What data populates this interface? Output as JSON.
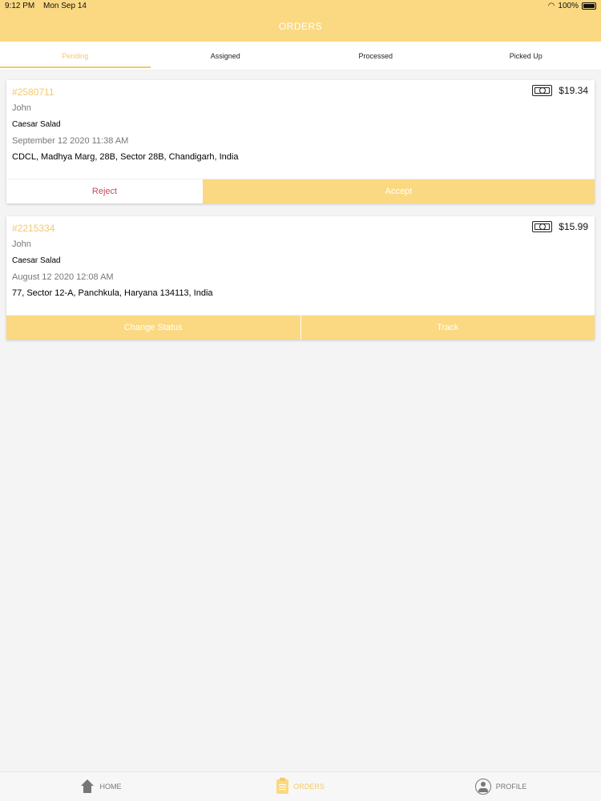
{
  "status_bar": {
    "time": "9:12 PM",
    "date": "Mon Sep 14",
    "battery": "100%"
  },
  "header": {
    "title": "ORDERS"
  },
  "tabs": [
    {
      "label": "Pending"
    },
    {
      "label": "Assigned"
    },
    {
      "label": "Processed"
    },
    {
      "label": "Picked Up"
    }
  ],
  "orders": [
    {
      "id": "#2580711",
      "price": "$19.34",
      "customer": "John",
      "item": "Caesar Salad",
      "date": "September 12 2020 11:38 AM",
      "address": "CDCL, Madhya Marg, 28B, Sector 28B, Chandigarh, India",
      "actions": {
        "left": "Reject",
        "right": "Accept"
      }
    },
    {
      "id": "#2215334",
      "price": "$15.99",
      "customer": "John",
      "item": "Caesar Salad",
      "date": "August 12 2020 12:08 AM",
      "address": "77, Sector 12-A, Panchkula, Haryana 134113, India",
      "actions": {
        "left": "Change Status",
        "right": "Track"
      }
    }
  ],
  "bottom_nav": [
    {
      "label": "HOME",
      "icon": "home-icon"
    },
    {
      "label": "ORDERS",
      "icon": "orders-icon"
    },
    {
      "label": "PROFILE",
      "icon": "profile-icon"
    }
  ],
  "colors": {
    "accent": "#fbd982",
    "accent_text": "#f4c96a",
    "reject": "#c9485e"
  }
}
